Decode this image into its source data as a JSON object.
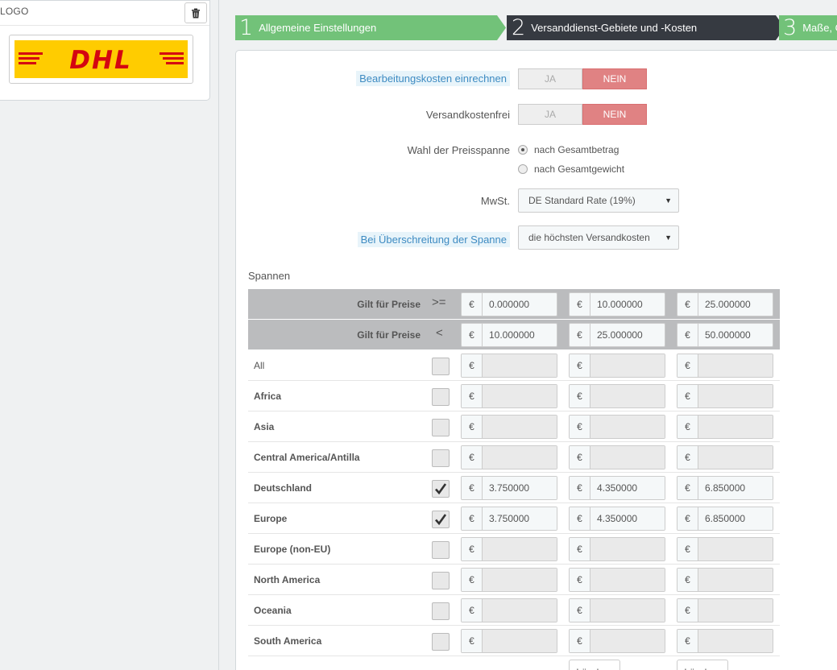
{
  "logo_panel": {
    "title": "LOGO",
    "trash_icon": "trash-icon",
    "logo_text": "DHL",
    "colors": {
      "dhl_yellow": "#ffcc00",
      "dhl_red": "#d40511"
    }
  },
  "wizard": {
    "steps": [
      {
        "num": "1",
        "label": "Allgemeine Einstellungen",
        "state": "done"
      },
      {
        "num": "2",
        "label": "Versanddienst-Gebiete und -Kosten",
        "state": "active"
      },
      {
        "num": "3",
        "label": "Maße, G",
        "state": "todo"
      }
    ]
  },
  "form": {
    "handling": {
      "label": "Bearbeitungskosten einrechnen",
      "yes": "JA",
      "no": "NEIN",
      "value": "NEIN"
    },
    "free_shipping": {
      "label": "Versandkostenfrei",
      "yes": "JA",
      "no": "NEIN",
      "value": "NEIN"
    },
    "billing": {
      "label": "Wahl der Preisspanne",
      "options": [
        "nach Gesamtbetrag",
        "nach Gesamtgewicht"
      ],
      "selected": "nach Gesamtbetrag"
    },
    "tax": {
      "label": "MwSt.",
      "value": "DE Standard Rate (19%)"
    },
    "out_of_range": {
      "label": "Bei Überschreitung der Spanne",
      "value": "die höchsten Versandkosten"
    }
  },
  "ranges": {
    "title": "Spannen",
    "currency": "€",
    "from": {
      "label": "Gilt für Preise",
      "op": ">=",
      "values": [
        "0.000000",
        "10.000000",
        "25.000000"
      ]
    },
    "to": {
      "label": "Gilt für Preise",
      "op": "<",
      "values": [
        "10.000000",
        "25.000000",
        "50.000000"
      ]
    },
    "zones": [
      {
        "name": "All",
        "bold": false,
        "checked": false,
        "values": [
          "",
          "",
          ""
        ]
      },
      {
        "name": "Africa",
        "bold": true,
        "checked": false,
        "values": [
          "",
          "",
          ""
        ]
      },
      {
        "name": "Asia",
        "bold": true,
        "checked": false,
        "values": [
          "",
          "",
          ""
        ]
      },
      {
        "name": "Central America/Antilla",
        "bold": true,
        "checked": false,
        "values": [
          "",
          "",
          ""
        ]
      },
      {
        "name": "Deutschland",
        "bold": true,
        "checked": true,
        "values": [
          "3.750000",
          "4.350000",
          "6.850000"
        ]
      },
      {
        "name": "Europe",
        "bold": true,
        "checked": true,
        "values": [
          "3.750000",
          "4.350000",
          "6.850000"
        ]
      },
      {
        "name": "Europe (non-EU)",
        "bold": true,
        "checked": false,
        "values": [
          "",
          "",
          ""
        ]
      },
      {
        "name": "North America",
        "bold": true,
        "checked": false,
        "values": [
          "",
          "",
          ""
        ]
      },
      {
        "name": "Oceania",
        "bold": true,
        "checked": false,
        "values": [
          "",
          "",
          ""
        ]
      },
      {
        "name": "South America",
        "bold": true,
        "checked": false,
        "values": [
          "",
          "",
          ""
        ]
      }
    ],
    "delete_label": "Löschen"
  }
}
